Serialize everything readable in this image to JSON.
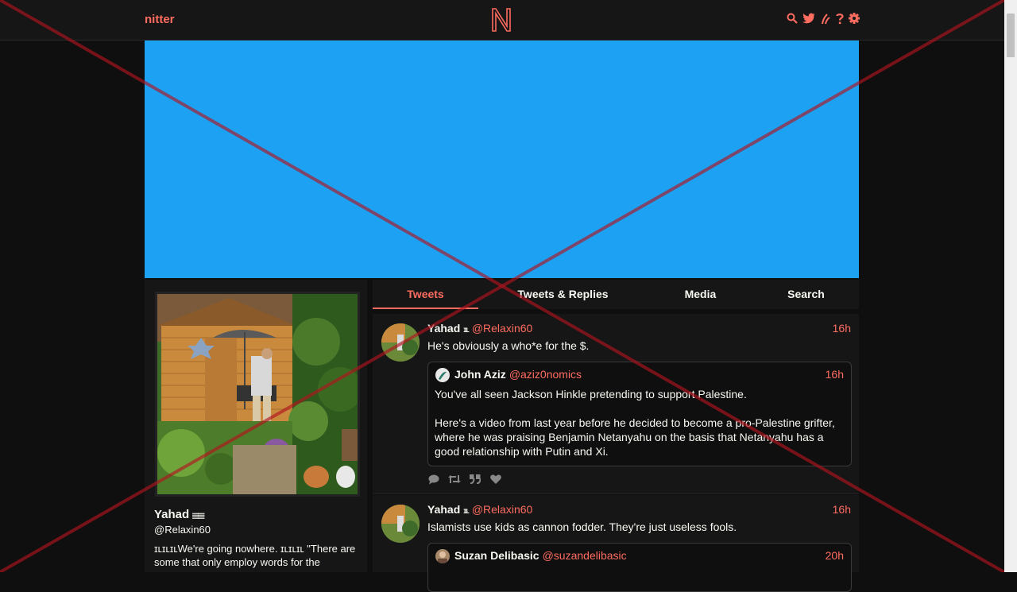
{
  "nav": {
    "brand": "nitter",
    "icons": [
      "search-icon",
      "twitter-bird-icon",
      "rss-icon",
      "help-icon",
      "gear-icon"
    ]
  },
  "colors": {
    "accent": "#ff6c60",
    "background": "#0f0f0f",
    "panel": "#161616",
    "banner": "#1da1f2"
  },
  "profile": {
    "name": "Yahad",
    "badge": "𝄙𝄙",
    "handle": "@Relaxin60",
    "bio": "ɪʟɪʟɪʟWe're going nowhere. ɪʟɪʟɪʟ \"There are some that only employ words for the"
  },
  "tabs": [
    "Tweets",
    "Tweets & Replies",
    "Media",
    "Search"
  ],
  "tweets": [
    {
      "fullname": "Yahad",
      "badge": "ɪʟ",
      "username": "@Relaxin60",
      "date": "16h",
      "text": "He's obviously a who*e for the $.",
      "quote": {
        "fullname": "John Aziz",
        "username": "@aziz0nomics",
        "date": "16h",
        "paragraphs": [
          "You've all seen Jackson Hinkle pretending to support Palestine.",
          "Here's a video from last year before he decided to become a pro-Palestine grifter, where he was praising Benjamin Netanyahu on the basis that Netanyahu has a good relationship with Putin and Xi."
        ]
      },
      "stats": [
        "comment-icon",
        "retweet-icon",
        "quote-icon",
        "heart-icon"
      ]
    },
    {
      "fullname": "Yahad",
      "badge": "ɪʟ",
      "username": "@Relaxin60",
      "date": "16h",
      "text": "Islamists use kids as cannon fodder. They're just useless fools.",
      "quote": {
        "fullname": "Suzan Delibasic",
        "username": "@suzandelibasic",
        "date": "20h"
      }
    }
  ]
}
